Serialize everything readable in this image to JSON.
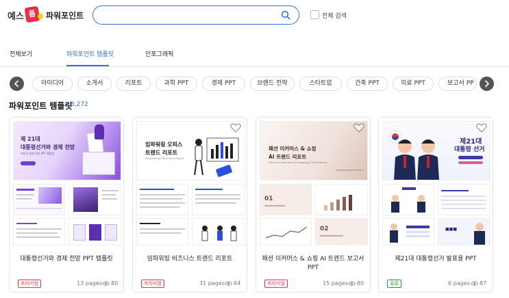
{
  "header": {
    "logo_text": "예스",
    "logo_badge": "폼",
    "service_name": "파워포인트",
    "search_placeholder": "",
    "all_search_label": "전체 검색"
  },
  "tabs": [
    {
      "label": "전체보기",
      "active": false
    },
    {
      "label": "파워포인트 템플릿",
      "active": true
    },
    {
      "label": "인포그래픽",
      "active": false
    }
  ],
  "categories": [
    "아이디어",
    "소개서",
    "리포트",
    "과학 PPT",
    "경제 PPT",
    "브랜드 전략",
    "스타트업",
    "건축 PPT",
    "의료 PPT",
    "보고서 PP"
  ],
  "section": {
    "title": "파워포인트 템플릿",
    "count": "8,272"
  },
  "cards": [
    {
      "title": "대통령선거와 경제 전망 PPT 템플릿",
      "badge": "프리미엄",
      "badge_type": "premium",
      "pages": "13 pages",
      "views": "80",
      "thumb_title_1": "제 21대",
      "thumb_title_2": "대통령선거와 경제 전망",
      "thumb_sub": "대선과 경제 전망 PPT 템플릿",
      "accent": "#7b3fd6"
    },
    {
      "title": "임파워링 비즈니스 트렌드 리포트",
      "badge": "프리미엄",
      "badge_type": "premium",
      "pages": "31 pages",
      "views": "64",
      "thumb_title_1": "임파워링 오피스",
      "thumb_title_2": "트렌드 리포트",
      "thumb_sub": "Empowering Office Trend Report",
      "accent": "#2a4fd8"
    },
    {
      "title": "패션 이커머스 & 쇼핑 AI 트렌드 보고서 PPT",
      "badge": "프리미엄",
      "badge_type": "premium",
      "pages": "15 pages",
      "views": "80",
      "thumb_title_1": "패션 이커머스 & 쇼핑",
      "thumb_title_2": "AI 트렌드 리포트",
      "thumb_sub": "Fashion E-commerce & Shopping AI Trend Report",
      "accent": "#8a5a4a"
    },
    {
      "title": "제21대 대통령선거 발표용 PPT",
      "badge": "유료",
      "badge_type": "free",
      "pages": "6 pages",
      "views": "87",
      "thumb_title_1": "제21대",
      "thumb_title_2": "대통령 선거",
      "thumb_sub": "",
      "accent": "#3b3ba8"
    }
  ],
  "colors": {
    "accent": "#2f6fdf",
    "premium": "#e8304c",
    "paid": "#1f9b3a"
  }
}
